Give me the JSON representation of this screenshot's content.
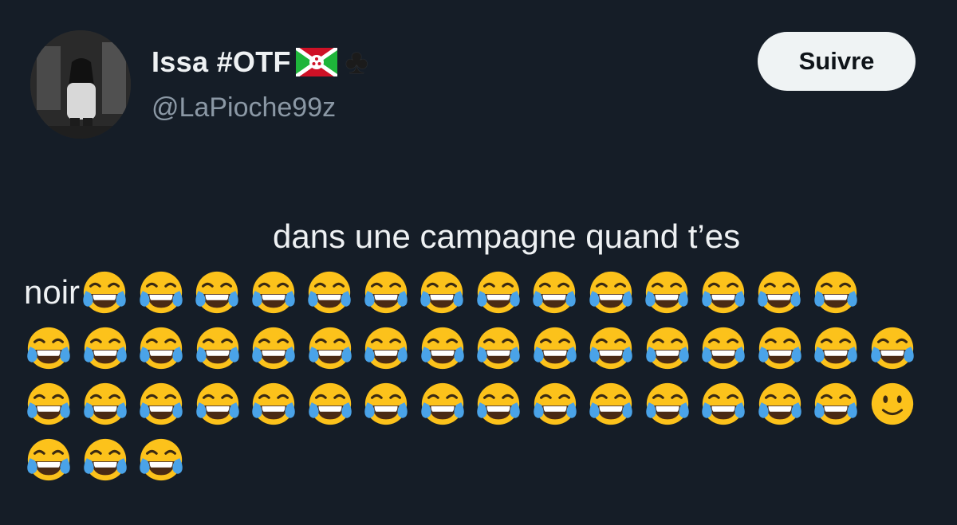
{
  "user": {
    "display_name": "Issa #OTF",
    "handle": "@LaPioche99z",
    "flag_emoji_icon": "burundi-flag-icon",
    "club_symbol": "♣"
  },
  "follow_button": {
    "label": "Suivre"
  },
  "tweet": {
    "line1_text": "dans une campagne quand t’es",
    "line2_text": "noir",
    "emoji_rows": [
      [
        "tears-of-joy",
        "tears-of-joy",
        "tears-of-joy",
        "tears-of-joy",
        "tears-of-joy",
        "tears-of-joy",
        "tears-of-joy",
        "tears-of-joy",
        "tears-of-joy",
        "tears-of-joy",
        "tears-of-joy",
        "tears-of-joy",
        "tears-of-joy",
        "tears-of-joy"
      ],
      [
        "tears-of-joy",
        "tears-of-joy",
        "tears-of-joy",
        "tears-of-joy",
        "tears-of-joy",
        "tears-of-joy",
        "tears-of-joy",
        "tears-of-joy",
        "tears-of-joy",
        "tears-of-joy",
        "tears-of-joy",
        "tears-of-joy",
        "tears-of-joy",
        "tears-of-joy",
        "tears-of-joy",
        "tears-of-joy"
      ],
      [
        "tears-of-joy",
        "tears-of-joy",
        "tears-of-joy",
        "tears-of-joy",
        "tears-of-joy",
        "tears-of-joy",
        "tears-of-joy",
        "tears-of-joy",
        "tears-of-joy",
        "tears-of-joy",
        "tears-of-joy",
        "tears-of-joy",
        "tears-of-joy",
        "tears-of-joy",
        "tears-of-joy",
        "slight-smile"
      ],
      [
        "tears-of-joy",
        "tears-of-joy",
        "tears-of-joy"
      ]
    ]
  },
  "colors": {
    "background": "#151d27",
    "text": "#eef1f3",
    "handle": "#8b98a5",
    "button_bg": "#eff3f4",
    "emoji_face": "#fcc21b",
    "emoji_tears": "#4aa3e8"
  }
}
